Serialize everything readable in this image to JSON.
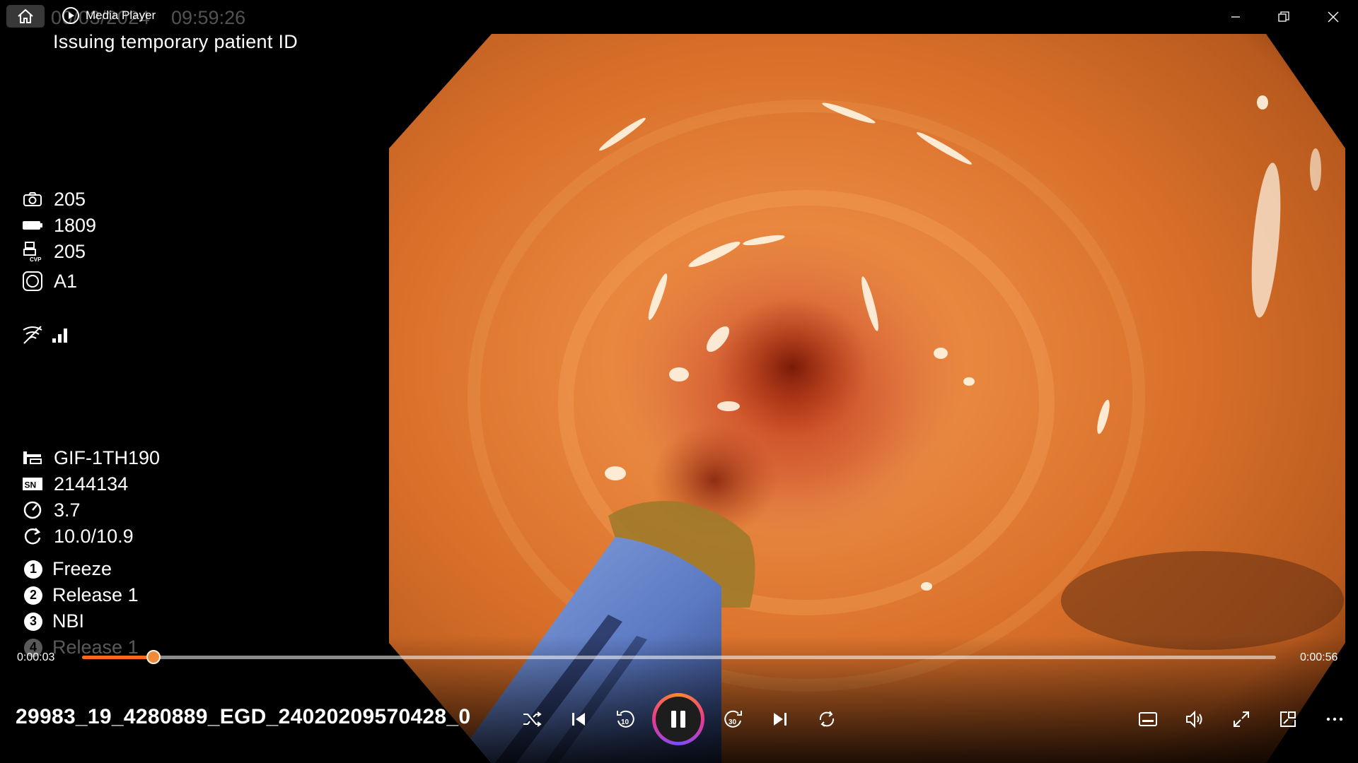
{
  "window": {
    "app_title": "Media Player",
    "ghost_date": "00/03/2024",
    "ghost_time": "09:59:26"
  },
  "overlay": {
    "status_line": "Issuing temporary patient ID",
    "counters": [
      {
        "icon": "camera-icon",
        "value": "205"
      },
      {
        "icon": "battery-icon",
        "value": "1809"
      },
      {
        "icon": "cvp-printer-icon",
        "value": "205"
      },
      {
        "icon": "structure-enhance-icon",
        "value": "A1"
      }
    ],
    "signal_icons": [
      "no-signal-icon",
      "signal-bars-icon"
    ],
    "scope_info": [
      {
        "icon": "scope-icon",
        "value": "GIF-1TH190"
      },
      {
        "icon": "sn-icon",
        "value": "2144134"
      },
      {
        "icon": "dial-icon",
        "value": "3.7"
      },
      {
        "icon": "rotate-icon",
        "value": "10.0/10.9"
      }
    ],
    "buttons": [
      {
        "num": "1",
        "label": "Freeze"
      },
      {
        "num": "2",
        "label": "Release 1"
      },
      {
        "num": "3",
        "label": "NBI"
      },
      {
        "num": "4",
        "label": "Release 1"
      }
    ]
  },
  "playback": {
    "current_time": "0:00:03",
    "total_time": "0:00:56",
    "progress": 0.06,
    "filename": "29983_19_4280889_EGD_24020209570428_0",
    "state": "playing"
  },
  "controls": {
    "left": [
      "shuffle-icon",
      "previous-icon",
      "rewind-10-icon",
      "pause-icon",
      "forward-30-icon",
      "next-icon",
      "repeat-icon"
    ],
    "right": [
      "subtitles-icon",
      "volume-icon",
      "fullscreen-icon",
      "mini-player-icon",
      "more-icon"
    ]
  },
  "colors": {
    "accent": "#ff6a1a",
    "mucosa": "#d9702a",
    "background": "#000000"
  }
}
